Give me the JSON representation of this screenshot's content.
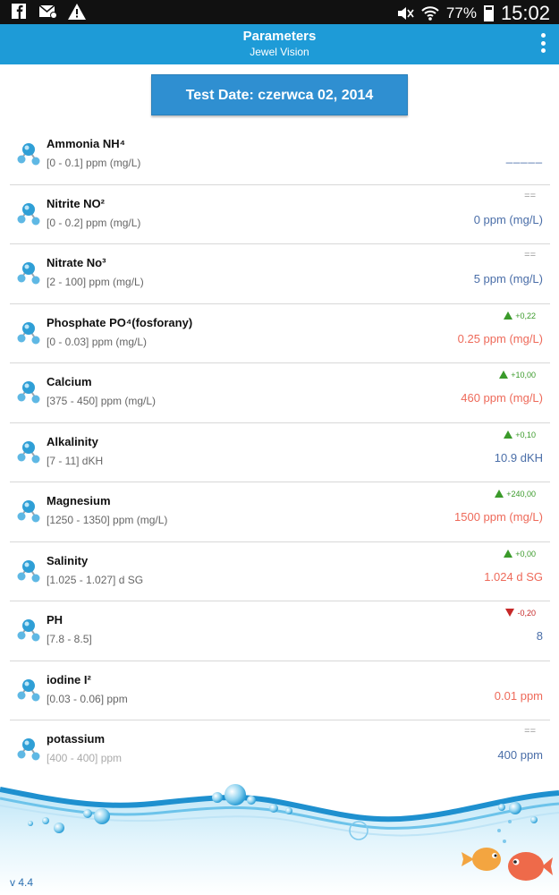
{
  "status_bar": {
    "battery_percent": "77%",
    "time": "15:02",
    "left_icons": [
      "facebook-icon",
      "email-icon",
      "warning-icon"
    ],
    "right_icons": [
      "mute-icon",
      "wifi-icon",
      "battery-icon"
    ]
  },
  "header": {
    "title": "Parameters",
    "subtitle": "Jewel Vision",
    "menu_icon": "overflow-menu-icon"
  },
  "test_date_label": "Test Date: czerwca 02, 2014",
  "parameters": [
    {
      "name": "Ammonia NH⁴",
      "range": "[0 - 0.1] ppm (mg/L)",
      "trend": "",
      "trend_dir": "none",
      "value": "_____",
      "value_style": "dash"
    },
    {
      "name": "Nitrite NO²",
      "range": "[0 - 0.2] ppm (mg/L)",
      "trend": "==",
      "trend_dir": "eq",
      "value": "0 ppm (mg/L)",
      "value_style": "blue"
    },
    {
      "name": "Nitrate No³",
      "range": "[2 - 100] ppm (mg/L)",
      "trend": "==",
      "trend_dir": "eq",
      "value": "5 ppm (mg/L)",
      "value_style": "blue"
    },
    {
      "name": "Phosphate PO⁴(fosforany)",
      "range": "[0 - 0.03] ppm (mg/L)",
      "trend": "+0,22",
      "trend_dir": "up",
      "value": "0.25 ppm (mg/L)",
      "value_style": "red"
    },
    {
      "name": "Calcium",
      "range": "[375 - 450] ppm (mg/L)",
      "trend": "+10,00",
      "trend_dir": "up",
      "value": "460 ppm (mg/L)",
      "value_style": "red"
    },
    {
      "name": "Alkalinity",
      "range": "[7 - 11] dKH",
      "trend": "+0,10",
      "trend_dir": "up",
      "value": "10.9 dKH",
      "value_style": "blue"
    },
    {
      "name": "Magnesium",
      "range": "[1250 - 1350] ppm (mg/L)",
      "trend": "+240,00",
      "trend_dir": "up",
      "value": "1500 ppm (mg/L)",
      "value_style": "red"
    },
    {
      "name": "Salinity",
      "range": "[1.025 - 1.027] d SG",
      "trend": "+0,00",
      "trend_dir": "up",
      "value": "1.024 d SG",
      "value_style": "red"
    },
    {
      "name": "PH",
      "range": "[7.8 - 8.5]",
      "trend": "-0,20",
      "trend_dir": "down",
      "value": "8",
      "value_style": "blue"
    },
    {
      "name": "iodine I²",
      "range": "[0.03 - 0.06] ppm",
      "trend": "",
      "trend_dir": "none",
      "value": "0.01 ppm",
      "value_style": "red"
    },
    {
      "name": "potassium",
      "range": "[400 - 400] ppm",
      "trend": "==",
      "trend_dir": "eq",
      "value": "400 ppm",
      "value_style": "blue",
      "range_style": "light"
    }
  ],
  "row_icon": "molecule-icon",
  "footer": {
    "version": "v 4.4",
    "decor": [
      "water-wave-image",
      "fish-icon"
    ]
  },
  "colors": {
    "header_blue": "#1e9bd7",
    "button_blue": "#2f8fd1",
    "value_blue": "#4a6ea8",
    "value_red": "#ee6a5a",
    "trend_up": "#3a9a2a",
    "trend_down": "#c62828"
  }
}
